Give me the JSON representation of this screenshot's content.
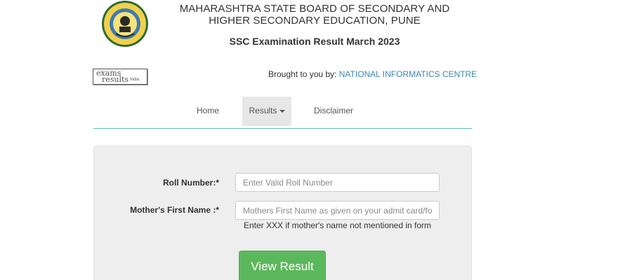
{
  "header": {
    "board_title": "MAHARASHTRA STATE BOARD OF SECONDARY AND HIGHER SECONDARY EDUCATION, PUNE",
    "exam_title": "SSC Examination Result March 2023"
  },
  "badge": {
    "line1": "exams",
    "line2": "results",
    "line3": "India"
  },
  "credit": {
    "prefix": "Brought to you by: ",
    "org": "NATIONAL INFORMATICS CENTRE"
  },
  "nav": {
    "home": "Home",
    "results": "Results",
    "disclaimer": "Disclaimer"
  },
  "form": {
    "roll_label": "Roll Number:*",
    "roll_placeholder": "Enter Valid Roll Number",
    "mother_label": "Mother's First Name :*",
    "mother_placeholder": "Mothers First Name as given on your admit card/form",
    "hint": "Enter XXX if mother's name not mentioned in form",
    "submit_label": "View Result"
  },
  "colors": {
    "accent_link": "#3a86b8",
    "nav_line": "#5fb7c9",
    "button": "#5cb85c",
    "panel": "#eeeeee"
  }
}
